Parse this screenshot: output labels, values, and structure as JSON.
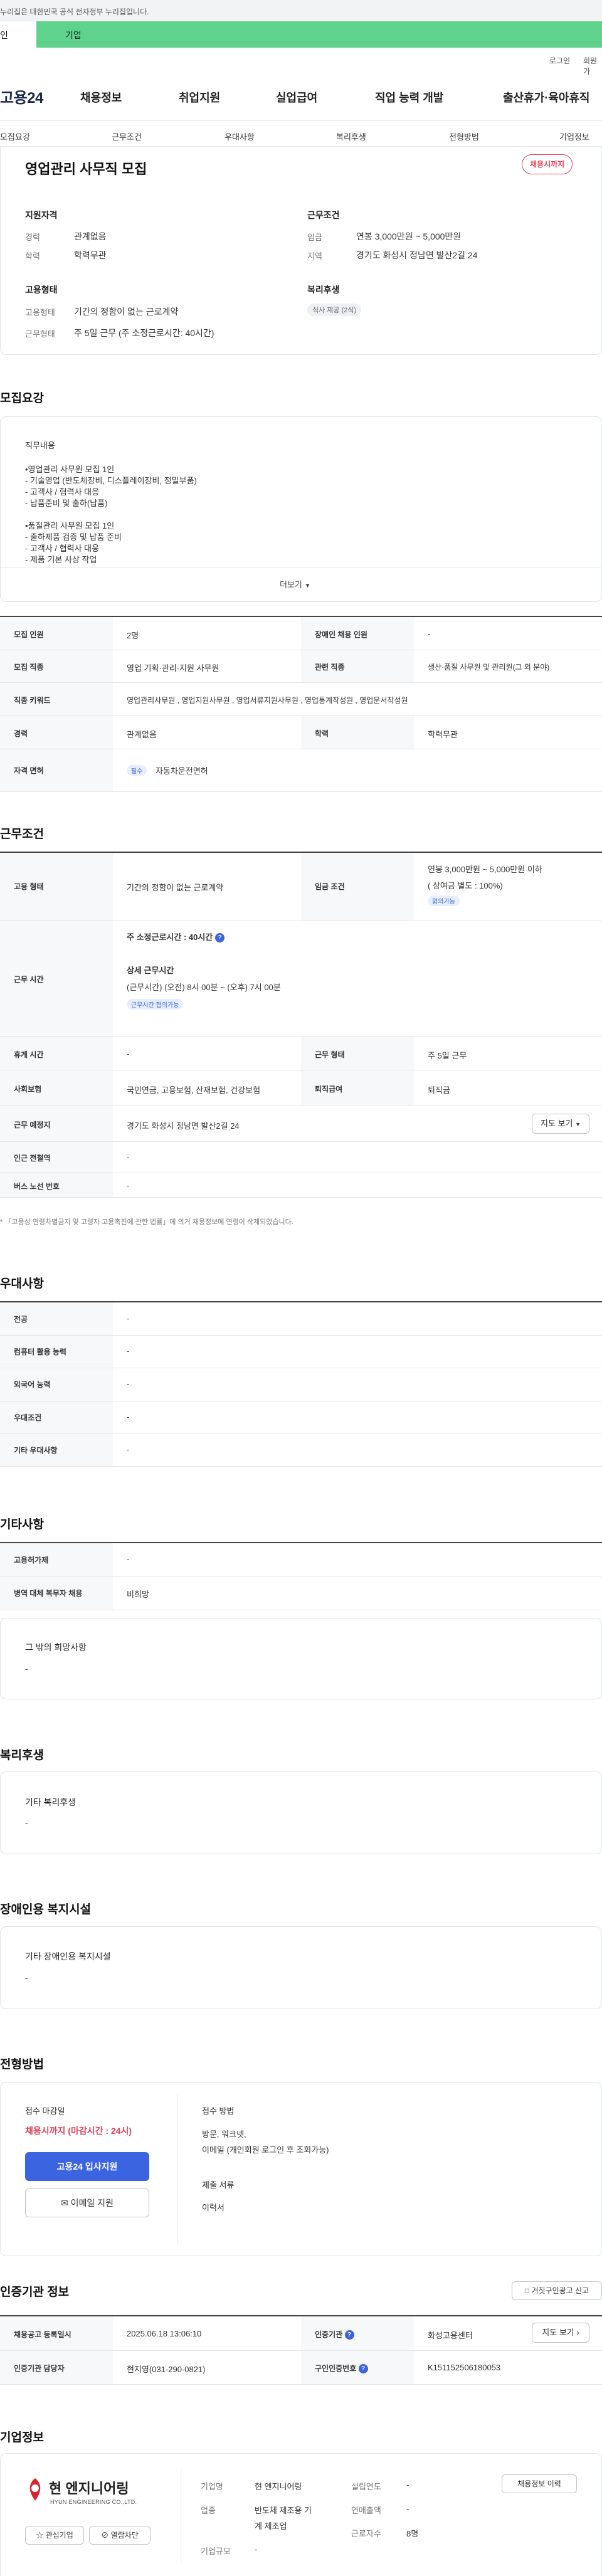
{
  "gov_banner": {
    "text": "누리집은 대한민국 공식 전자정부 누리집입니다."
  },
  "top_tabs": {
    "individual": "인",
    "business": "기업"
  },
  "util": {
    "login": "로그인",
    "join": "회원가"
  },
  "header": {
    "logo": "고용24",
    "gnb": [
      "채용정보",
      "취업지원",
      "실업급여",
      "직업 능력 개발",
      "출산휴가·육아휴직"
    ]
  },
  "snb": [
    "모집요강",
    "근무조건",
    "우대사항",
    "복리후생",
    "전형방법",
    "기업정보"
  ],
  "summary": {
    "title": "영업관리 사무직 모집",
    "status": "채용시까지",
    "qualification": {
      "heading": "지원자격",
      "career_label": "경력",
      "career_value": "관계없음",
      "education_label": "학력",
      "education_value": "학력무관"
    },
    "conditions": {
      "heading": "근무조건",
      "wage_label": "임금",
      "wage_value": "연봉 3,000만원 ~ 5,000만원",
      "region_label": "지역",
      "region_value": "경기도 화성시 정남면 발산2길 24"
    },
    "employment": {
      "heading": "고용형태",
      "type_label": "고용형태",
      "type_value": "기간의 정함이 없는 근로계약",
      "work_label": "근무형태",
      "work_value": "주 5일 근무 (주 소정근로시간: 40시간)"
    },
    "welfare": {
      "heading": "복리후생",
      "chip": "식사 제공 (2식)"
    }
  },
  "recruit": {
    "title": "모집요강",
    "duty_heading": "직무내용",
    "duty_lines": [
      "•영업관리 사무원 모집 1인",
      "- 기술영업 (반도체장비, 디스플레이장비, 정밀부품)",
      "- 고객사 / 협력사 대응",
      "- 납품준비 및 출하(납품)",
      "",
      "•품질관리 사무원 모집 1인",
      "- 출하제품 검증 및 납품 준비",
      "- 고객사 / 협력사 대응",
      "- 제품 기본 사상 작업"
    ],
    "more": "더보기",
    "table": {
      "headcount_label": "모집 인원",
      "headcount_value": "2명",
      "disabled_label": "장애인 채용 인원",
      "disabled_value": "-",
      "job_label": "모집 직종",
      "job_value": "영업 기획·관리·지원 사무원",
      "related_label": "관련 직종",
      "related_value": "생산·품질 사무원 및 관리원(그 외 분야)",
      "keyword_label": "직종 키워드",
      "keyword_value": "영업관리사무원 , 영업지원사무원 , 영업서류지원사무원 , 영업통계작성원 , 영업문서작성원",
      "career_label": "경력",
      "career_value": "관계없음",
      "edu_label": "학력",
      "edu_value": "학력무관",
      "license_label": "자격 면허",
      "license_badge": "필수",
      "license_value": "자동차운전면허"
    }
  },
  "work": {
    "title": "근무조건",
    "emp_label": "고용 형태",
    "emp_value": "기간의 정함이 없는 근로계약",
    "wage_label": "임금 조건",
    "wage_value": "연봉 3,000만원 ~ 5,000만원 이하",
    "wage_bonus": "( 상여금 별도 : 100%)",
    "wage_badge": "협의가능",
    "hours_label": "근무 시간",
    "hours_weekly": "주 소정근로시간 : 40시간",
    "hours_detail_title": "상세 근무시간",
    "hours_detail_value": "(근무시간) (오전) 8시 00분 ~ (오후) 7시 00분",
    "hours_badge": "근무시간 협의가능",
    "holiday_label": "휴게 시간",
    "holiday_value": "-",
    "shift_label": "근무 형태",
    "shift_value": "주 5일 근무",
    "insurance_label": "사회보험",
    "insurance_value": "국민연금, 고용보험, 산재보험, 건강보험",
    "severance_label": "퇴직급여",
    "severance_value": "퇴직금",
    "place_label": "근무 예정지",
    "place_value": "경기도 화성시 정남면 발산2길 24",
    "map_btn": "지도 보기",
    "subway_label": "인근 전철역",
    "subway_value": "-",
    "bus_label": "버스 노선 번호",
    "bus_value": "-",
    "note": "* 「고용상 연령차별금지 및 고령자 고용촉진에 관한 법률」에 의거 채용정보에 연령이 삭제되었습니다."
  },
  "preference": {
    "title": "우대사항",
    "rows": [
      {
        "label": "전공",
        "value": "-"
      },
      {
        "label": "컴퓨터 활용 능력",
        "value": "-"
      },
      {
        "label": "외국어 능력",
        "value": "-"
      },
      {
        "label": "우대조건",
        "value": "-"
      },
      {
        "label": "기타 우대사항",
        "value": "-"
      }
    ]
  },
  "etc": {
    "title": "기타사항",
    "rows": [
      {
        "label": "고용허가제",
        "value": "-"
      },
      {
        "label": "병역 대체 복무자 채용",
        "value": "비희망"
      }
    ],
    "other_title": "그 밖의 희망사항",
    "other_value": "-"
  },
  "welfare": {
    "title": "복리후생",
    "box_title": "기타 복리후생",
    "box_value": "-"
  },
  "disabled_facility": {
    "title": "장애인용 복지시설",
    "box_title": "기타 장애인용 복지시설",
    "box_value": "-"
  },
  "process": {
    "title": "전형방법",
    "deadline_label": "접수 마감일",
    "deadline_value": "채용시까지 (마감시간 : 24시)",
    "apply_btn": "고용24 입사지원",
    "email_btn": "이메일 지원",
    "method_label": "접수 방법",
    "method_value1": "방문, 워크넷,",
    "method_value2": "이메일 (개인회원 로그인 후 조회가능)",
    "docs_label": "제출 서류",
    "docs_value": "이력서"
  },
  "agency": {
    "title": "인증기관 정보",
    "report_btn": "거짓구인광고 신고",
    "reg_label": "채용공고 등록일시",
    "reg_value": "2025.06.18 13:06:10",
    "org_label": "인증기관",
    "org_value": "화성고용센터",
    "map_btn": "지도 보기",
    "manager_label": "인증기관 담당자",
    "manager_value": "현지영(031-290-0821)",
    "req_label": "구인인증번호",
    "req_value": "K151152506180053"
  },
  "company": {
    "title": "기업정보",
    "logo_kr": "현 엔지니어링",
    "logo_en": "HYUN ENGINEERING CO.,LTD.",
    "fav_btn": "관심기업",
    "block_btn": "열람차단",
    "name_label": "기업명",
    "name_value": "현 엔지니어링",
    "ind_label": "업종",
    "ind_value1": "반도체 제조용 기",
    "ind_value2": "계 제조업",
    "size_label": "기업규모",
    "size_value": "-",
    "year_label": "설립연도",
    "year_value": "-",
    "sales_label": "연매출액",
    "sales_value": "-",
    "emp_label": "근로자수",
    "emp_value": "8명",
    "history_btn": "채용정보 이력"
  },
  "colors": {
    "accent_green": "#5fd38d",
    "brand_blue": "#3a64e0",
    "danger_red": "#e2435a"
  }
}
